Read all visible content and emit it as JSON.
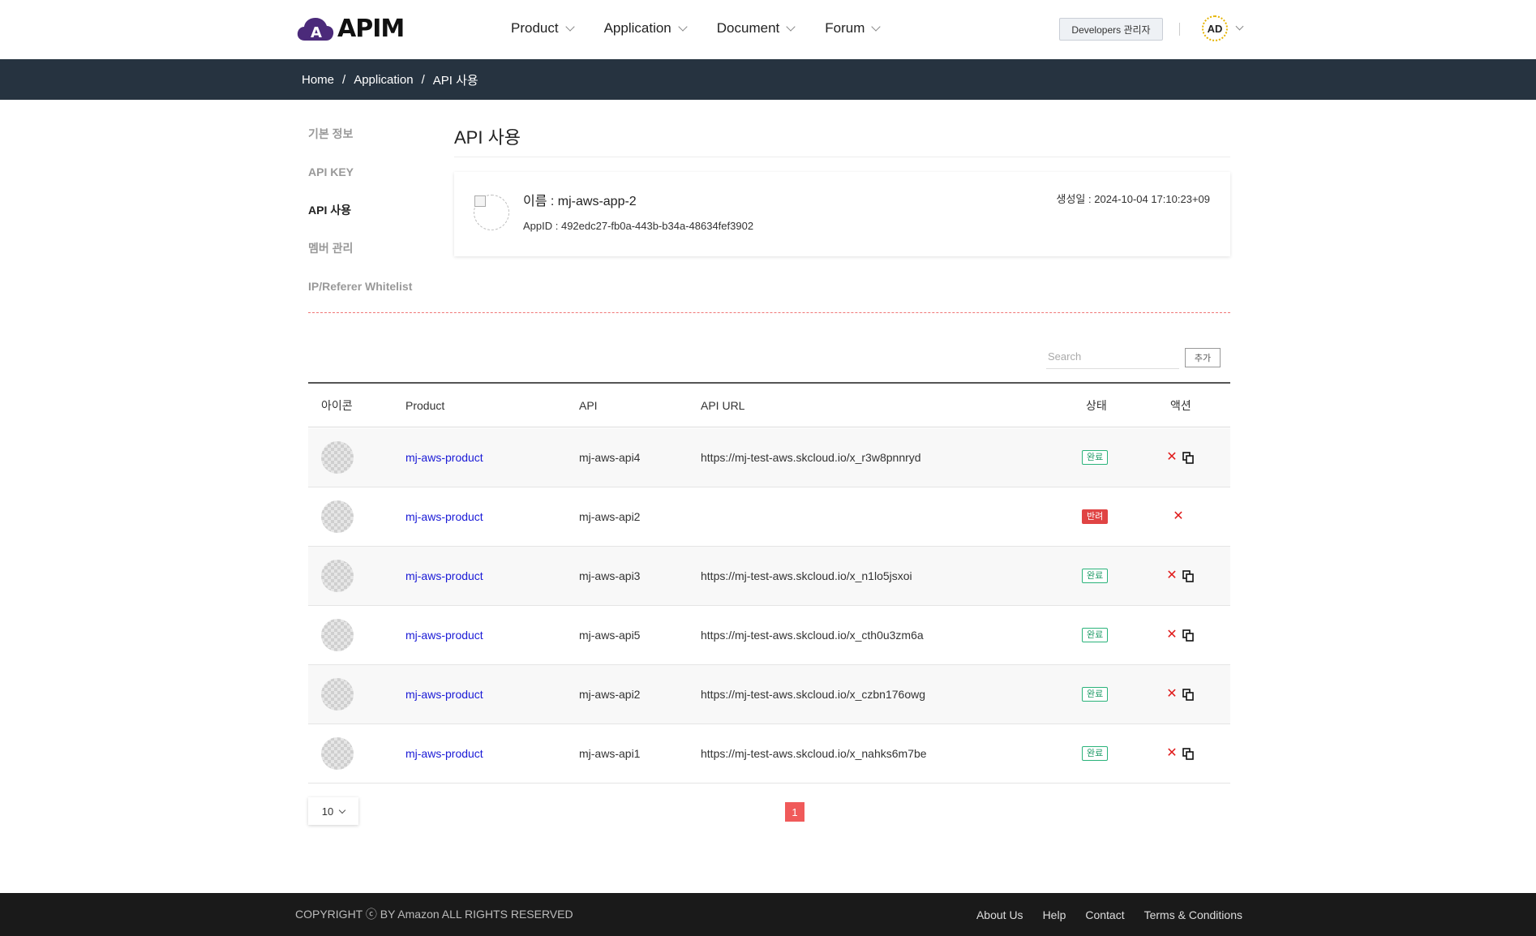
{
  "header": {
    "logo_text": "APIM",
    "nav": [
      {
        "label": "Product"
      },
      {
        "label": "Application"
      },
      {
        "label": "Document"
      },
      {
        "label": "Forum"
      }
    ],
    "admin_button": "Developers 관리자",
    "avatar_initials": "AD"
  },
  "breadcrumb": [
    "Home",
    "Application",
    "API 사용"
  ],
  "sidebar": {
    "items": [
      {
        "label": "기본 정보"
      },
      {
        "label": "API KEY"
      },
      {
        "label": "API 사용",
        "active": true
      },
      {
        "label": "멤버 관리"
      },
      {
        "label": "IP/Referer Whitelist"
      }
    ]
  },
  "main": {
    "title": "API 사용",
    "app": {
      "name": "이름 : mj-aws-app-2",
      "app_id": "AppID : 492edc27-fb0a-443b-b34a-48634fef3902",
      "created": "생성일 : 2024-10-04 17:10:23+09"
    },
    "search": {
      "placeholder": "Search",
      "value": ""
    },
    "add_button": "추가",
    "table": {
      "headers": [
        "아이콘",
        "Product",
        "API",
        "API URL",
        "상태",
        "액션"
      ],
      "rows": [
        {
          "product": "mj-aws-product",
          "api": "mj-aws-api4",
          "url": "https://mj-test-aws.skcloud.io/x_r3w8pnnryd",
          "status": "완료",
          "status_type": "ok"
        },
        {
          "product": "mj-aws-product",
          "api": "mj-aws-api2",
          "url": "",
          "status": "반려",
          "status_type": "rejected"
        },
        {
          "product": "mj-aws-product",
          "api": "mj-aws-api3",
          "url": "https://mj-test-aws.skcloud.io/x_n1lo5jsxoi",
          "status": "완료",
          "status_type": "ok"
        },
        {
          "product": "mj-aws-product",
          "api": "mj-aws-api5",
          "url": "https://mj-test-aws.skcloud.io/x_cth0u3zm6a",
          "status": "완료",
          "status_type": "ok"
        },
        {
          "product": "mj-aws-product",
          "api": "mj-aws-api2",
          "url": "https://mj-test-aws.skcloud.io/x_czbn176owg",
          "status": "완료",
          "status_type": "ok"
        },
        {
          "product": "mj-aws-product",
          "api": "mj-aws-api1",
          "url": "https://mj-test-aws.skcloud.io/x_nahks6m7be",
          "status": "완료",
          "status_type": "ok"
        }
      ]
    },
    "page_size": "10",
    "current_page": "1"
  },
  "footer": {
    "copyright": "COPYRIGHT ⓒ BY Amazon ALL RIGHTS RESERVED",
    "links": [
      "About Us",
      "Help",
      "Contact",
      "Terms & Conditions"
    ]
  },
  "colors": {
    "breadcrumb_bg": "#263340",
    "footer_bg": "#1a1a1a",
    "link_blue": "#1a1ad6",
    "status_ok": "#1e9a66",
    "status_rejected": "#e04444",
    "page_active": "#f05a5a",
    "logo_purple": "#4b2a7a"
  }
}
